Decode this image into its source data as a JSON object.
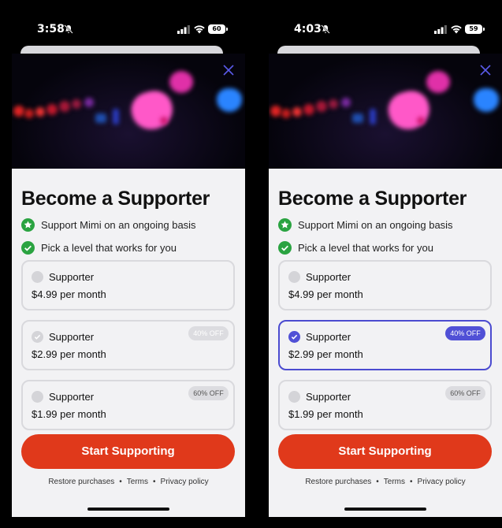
{
  "colors": {
    "accent": "#e0391b",
    "selected": "#5050d6",
    "check_green": "#2aa341"
  },
  "screens": [
    {
      "status": {
        "time": "3:58",
        "battery": "60"
      },
      "title": "Become a Supporter",
      "bullets": [
        {
          "icon": "star-circle-icon",
          "text": "Support Mimi on an ongoing basis"
        },
        {
          "icon": "check-circle-icon",
          "text": "Pick a level that works for you"
        }
      ],
      "plans": [
        {
          "name": "Supporter",
          "price": "$4.99 per month",
          "badge": ""
        },
        {
          "name": "Supporter",
          "price": "$2.99 per month",
          "badge": "40% OFF"
        },
        {
          "name": "Supporter",
          "price": "$1.99 per month",
          "badge": "60% OFF"
        }
      ],
      "cta": "Start Supporting",
      "footer": {
        "restore": "Restore purchases",
        "terms": "Terms",
        "privacy": "Privacy policy"
      }
    },
    {
      "status": {
        "time": "4:03",
        "battery": "59"
      },
      "title": "Become a Supporter",
      "bullets": [
        {
          "icon": "star-circle-icon",
          "text": "Support Mimi on an ongoing basis"
        },
        {
          "icon": "check-circle-icon",
          "text": "Pick a level that works for you"
        }
      ],
      "plans": [
        {
          "name": "Supporter",
          "price": "$4.99 per month",
          "badge": ""
        },
        {
          "name": "Supporter",
          "price": "$2.99 per month",
          "badge": "40% OFF"
        },
        {
          "name": "Supporter",
          "price": "$1.99 per month",
          "badge": "60% OFF"
        }
      ],
      "cta": "Start Supporting",
      "footer": {
        "restore": "Restore purchases",
        "terms": "Terms",
        "privacy": "Privacy policy"
      }
    }
  ]
}
